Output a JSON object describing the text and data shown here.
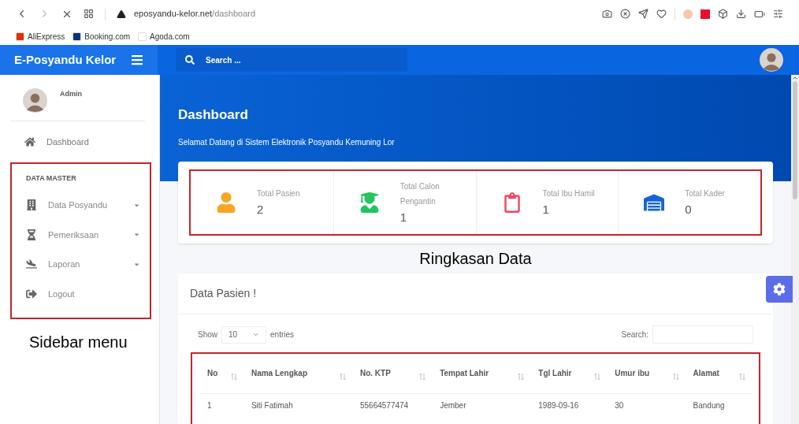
{
  "browser": {
    "url_host": "eposyandu-kelor.net",
    "url_path": "/dashboard",
    "bookmarks": [
      {
        "label": "AliExpress",
        "color": "#e62e04"
      },
      {
        "label": "Booking.com",
        "color": "#003580"
      },
      {
        "label": "Agoda.com",
        "color": "#ffffff"
      }
    ]
  },
  "app": {
    "brand": "E-Posyandu Kelor",
    "search": {
      "placeholder": "Search ..."
    }
  },
  "sidebar": {
    "user": "Admin",
    "top_items": [
      {
        "label": "Dashboard",
        "kind": "home"
      }
    ],
    "section": "DATA MASTER",
    "items": [
      {
        "label": "Data Posyandu",
        "kind": "building",
        "expandable": true
      },
      {
        "label": "Pemeriksaan",
        "kind": "hourglass",
        "expandable": true
      },
      {
        "label": "Laporan",
        "kind": "plane",
        "expandable": true
      },
      {
        "label": "Logout",
        "kind": "logout",
        "expandable": false
      }
    ]
  },
  "hero": {
    "title": "Dashboard",
    "subtitle": "Selamat Datang di Sistem Elektronik Posyandu Kemuning Lor"
  },
  "stats": [
    {
      "label": "Total Pasien",
      "value": "2",
      "kind": "user",
      "color": "#f6a623"
    },
    {
      "label": "Total Calon Pengantin",
      "value": "1",
      "kind": "graduate",
      "color": "#22c55e"
    },
    {
      "label": "Total Ibu Hamil",
      "value": "1",
      "kind": "clipboard",
      "color": "#f0475f"
    },
    {
      "label": "Total Kader",
      "value": "0",
      "kind": "warehouse",
      "color": "#1565d8"
    }
  ],
  "annotations": {
    "sidebar": "Sidebar menu",
    "stats": "Ringkasan Data"
  },
  "table": {
    "title": "Data Pasien !",
    "show_label": "Show",
    "page_size": "10",
    "entries_label": "entries",
    "search_label": "Search:",
    "columns": [
      "No",
      "Nama Lengkap",
      "No. KTP",
      "Tempat Lahir",
      "Tgl Lahir",
      "Umur ibu",
      "Alamat"
    ],
    "rows": [
      [
        "1",
        "Siti Fatimah",
        "55664577474",
        "Jember",
        "1989-09-16",
        "30",
        "Bandung"
      ]
    ]
  }
}
